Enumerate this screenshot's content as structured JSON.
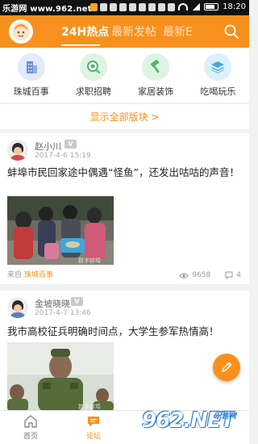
{
  "status_bar": {
    "site_text": "乐游网 www.962.net",
    "time": "18:20"
  },
  "header": {
    "tabs": [
      {
        "label": "24H热点",
        "active": true
      },
      {
        "label": "最新发帖",
        "active": false
      },
      {
        "label": "最新E",
        "active": false
      }
    ],
    "accent_color": "#f8901d"
  },
  "categories": [
    {
      "label": "珠城百事",
      "icon": "building-icon",
      "color": "#6b8fd8",
      "bg": "#e3ebfa"
    },
    {
      "label": "求职招聘",
      "icon": "search-job-icon",
      "color": "#4cb86a",
      "bg": "#dff3e3"
    },
    {
      "label": "家居装饰",
      "icon": "hammer-icon",
      "color": "#4cb86a",
      "bg": "#dff3e3"
    },
    {
      "label": "吃喝玩乐",
      "icon": "layers-icon",
      "color": "#4aa6d8",
      "bg": "#dcf0fa"
    }
  ],
  "show_all": "显示全部版块 >",
  "posts": [
    {
      "username": "赵小川",
      "badge": "V",
      "time": "2017-4-6 15:19",
      "title": "蚌埠市民回家途中偶遇“怪鱼”，还发出咕咕的声音！",
      "source_prefix": "来自",
      "forum": "珠城百事",
      "views": "9658",
      "comments": "4"
    },
    {
      "username": "金坡晓晓",
      "badge": "V",
      "time": "2017-4-7 13:46",
      "title": "我市高校征兵明确时间点，大学生参军热情高！"
    }
  ],
  "bottom_nav": [
    {
      "label": "首页",
      "icon": "home-icon",
      "active": false
    },
    {
      "label": "论坛",
      "icon": "forum-icon",
      "active": true
    }
  ],
  "watermark": {
    "logo": "962.NET",
    "brand": "乐游网"
  }
}
